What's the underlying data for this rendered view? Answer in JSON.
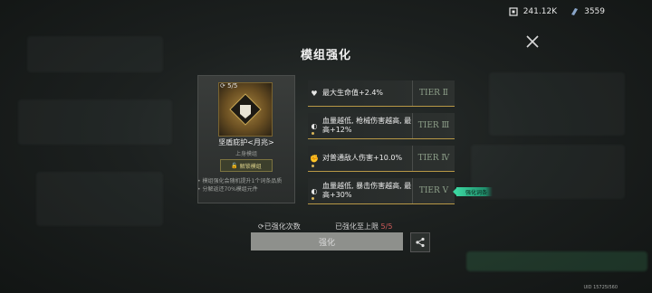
{
  "top": {
    "resource1": "241.12K",
    "resource2": "3559"
  },
  "title": "模组强化",
  "module": {
    "count": "5/5",
    "name": "坚盾庇护<月兆>",
    "slot": "上身模组",
    "lock_label": "解锁模组"
  },
  "notes": [
    "模组强化会随机提升1个词条品质",
    "分解返还70%模组元件"
  ],
  "stats": [
    {
      "icon": "heart-icon",
      "text": "最大生命值+2.4%",
      "tier": "TIER Ⅱ"
    },
    {
      "icon": "moon-icon",
      "text": "血量越低, 枪械伤害越高, 最高+12%",
      "tier": "TIER Ⅲ"
    },
    {
      "icon": "fist-icon",
      "text": "对普通敌人伤害+10.0%",
      "tier": "TIER Ⅳ"
    },
    {
      "icon": "moon-icon",
      "text": "血量越低, 暴击伤害越高, 最高+30%",
      "tier": "TIER Ⅴ"
    }
  ],
  "entry_tag": "强化词条",
  "bottom": {
    "enhance_count_label": "已强化次数",
    "max_label": "已强化至上限",
    "max_value": "5/5",
    "enhance_button": "强化"
  },
  "uid": "UID 15725I560",
  "colors": {
    "gold": "#b89846",
    "tier": "#8ea08a",
    "accent_green": "#3bd6a0",
    "warn_red": "#d05a5a"
  }
}
